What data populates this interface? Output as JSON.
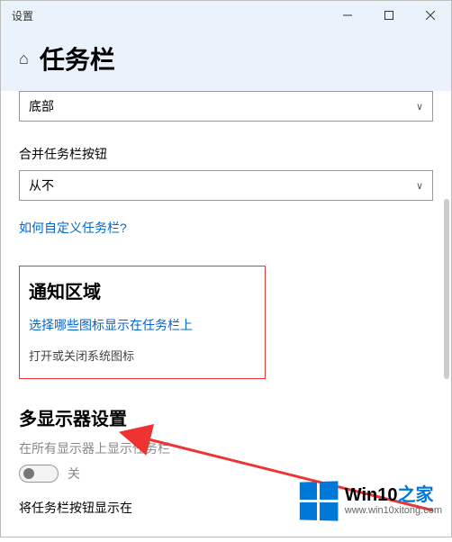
{
  "window": {
    "title": "设置"
  },
  "header": {
    "page_title": "任务栏"
  },
  "position": {
    "value": "底部"
  },
  "combine": {
    "label": "合并任务栏按钮",
    "value": "从不"
  },
  "customize_link": "如何自定义任务栏?",
  "notification": {
    "title": "通知区域",
    "link": "选择哪些图标显示在任务栏上",
    "sub": "打开或关闭系统图标"
  },
  "multi": {
    "title": "多显示器设置",
    "show_all_label": "在所有显示器上显示任务栏",
    "toggle_state": "关",
    "show_buttons_label": "将任务栏按钮显示在"
  },
  "watermark": {
    "main1": "Win10",
    "main2": "之家",
    "url": "www.win10xitong.com"
  }
}
